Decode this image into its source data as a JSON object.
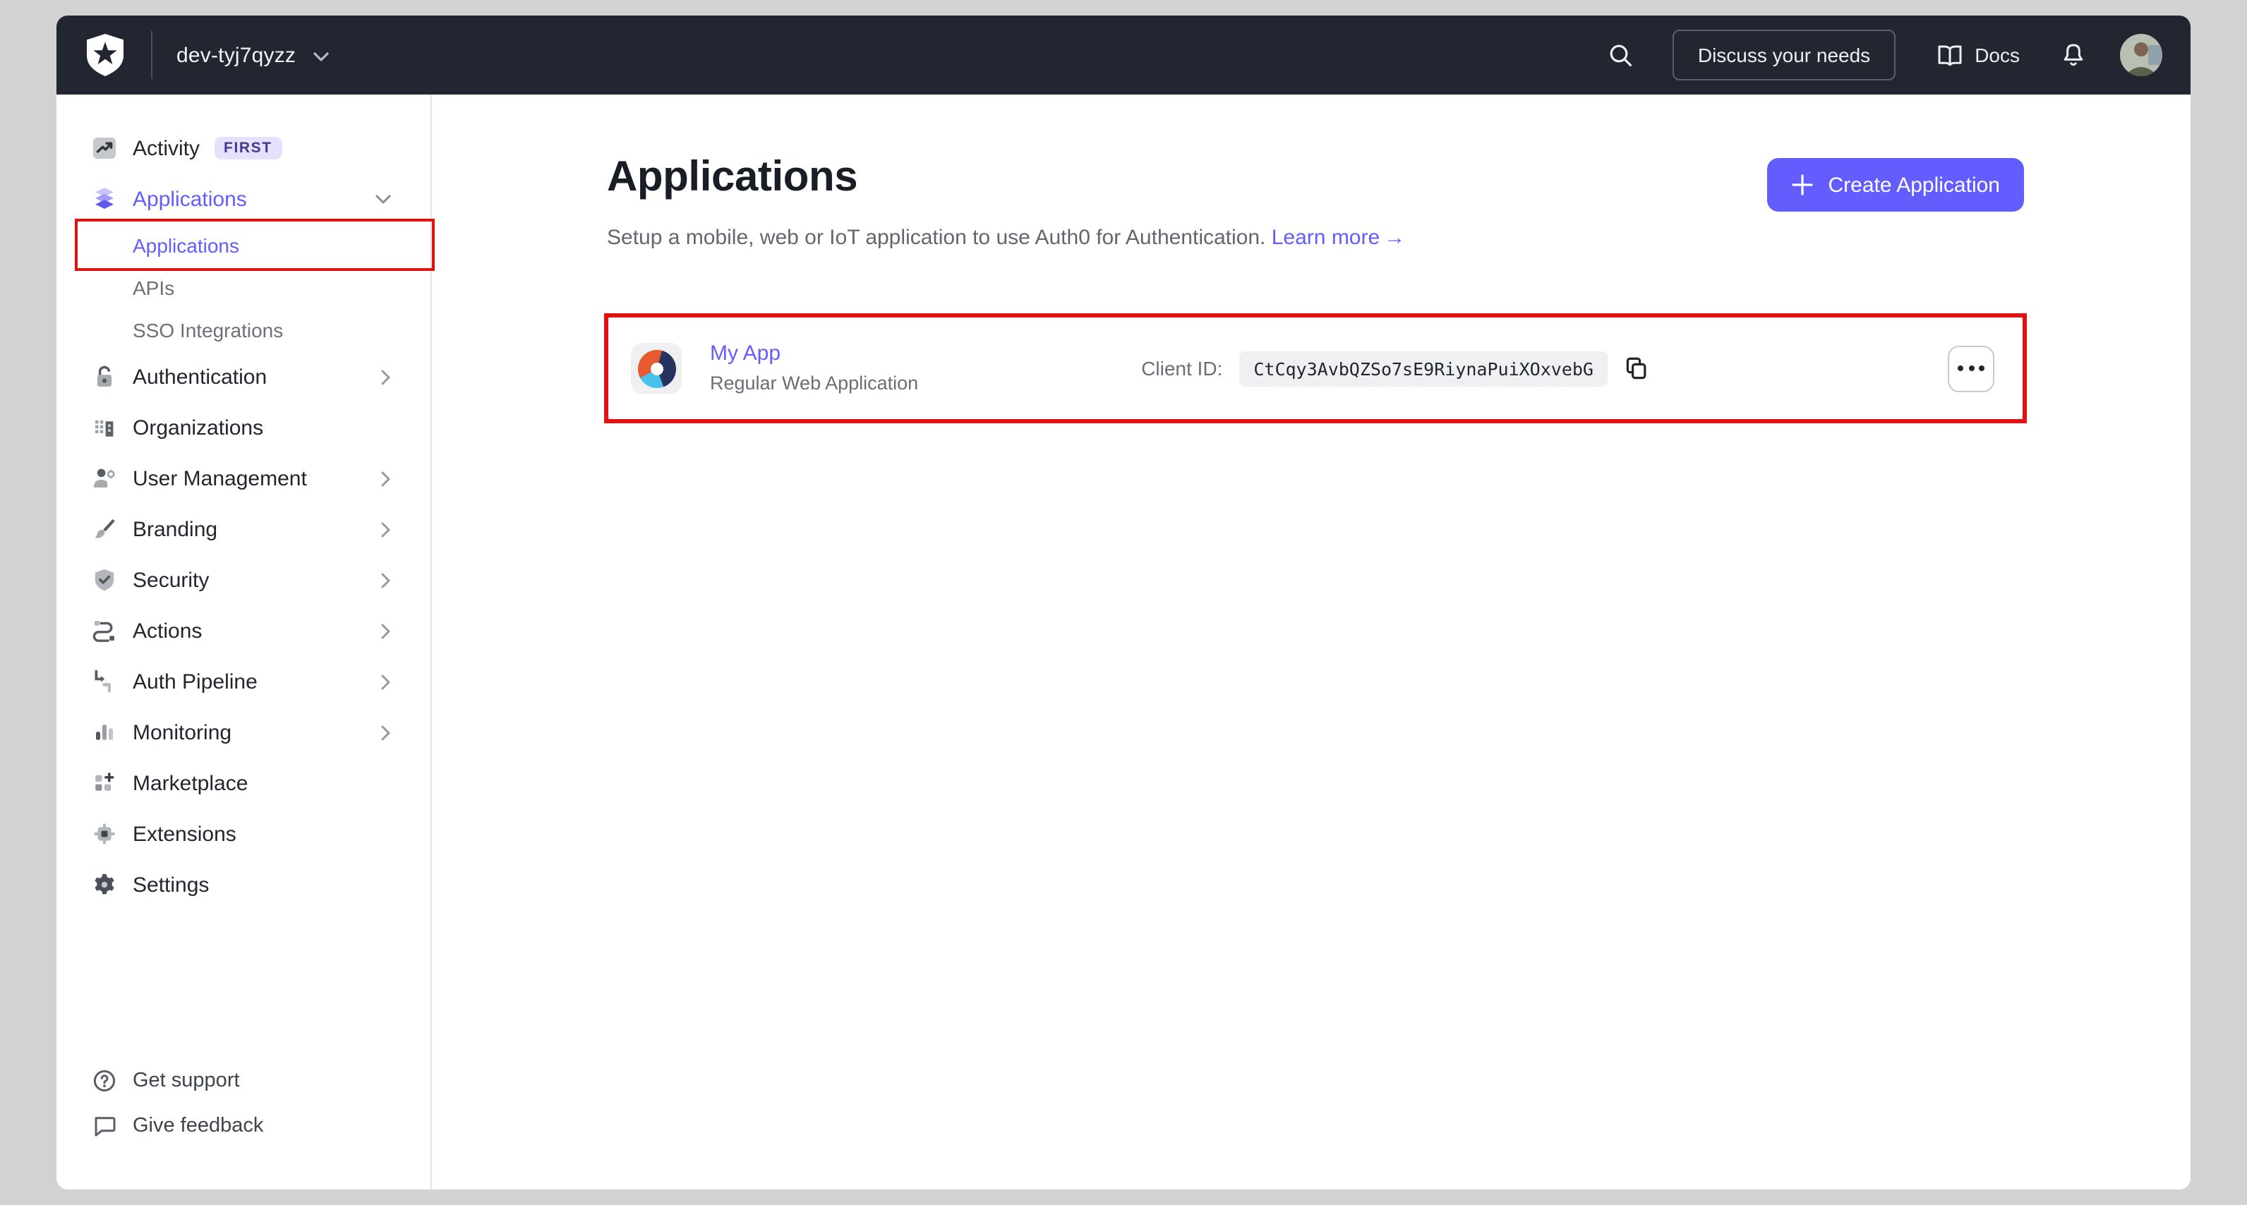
{
  "topbar": {
    "tenant_name": "dev-tyj7qyzz",
    "discuss_button_label": "Discuss your needs",
    "docs_label": "Docs"
  },
  "sidebar": {
    "items": [
      {
        "label": "Activity",
        "badge": "FIRST"
      },
      {
        "label": "Applications"
      },
      {
        "label": "Authentication"
      },
      {
        "label": "Organizations"
      },
      {
        "label": "User Management"
      },
      {
        "label": "Branding"
      },
      {
        "label": "Security"
      },
      {
        "label": "Actions"
      },
      {
        "label": "Auth Pipeline"
      },
      {
        "label": "Monitoring"
      },
      {
        "label": "Marketplace"
      },
      {
        "label": "Extensions"
      },
      {
        "label": "Settings"
      }
    ],
    "applications_subitems": [
      {
        "label": "Applications",
        "selected": true
      },
      {
        "label": "APIs"
      },
      {
        "label": "SSO Integrations"
      }
    ],
    "footer": [
      {
        "label": "Get support"
      },
      {
        "label": "Give feedback"
      }
    ]
  },
  "main": {
    "page_title": "Applications",
    "subtitle": "Setup a mobile, web or IoT application to use Auth0 for Authentication.",
    "learn_more_label": "Learn more",
    "learn_more_arrow": "→",
    "create_button_label": "Create Application",
    "application_row": {
      "name": "My App",
      "type": "Regular Web Application",
      "client_id_label": "Client ID:",
      "client_id": "CtCqy3AvbQZSo7sE9RiynaPuiXOxvebG"
    }
  },
  "colors": {
    "accent": "#635dff",
    "topbar_bg": "#212631",
    "annotation_red": "#e01212",
    "app_icon_orange": "#e7592e",
    "app_icon_navy": "#28325e",
    "app_icon_blue": "#47c2ec"
  }
}
